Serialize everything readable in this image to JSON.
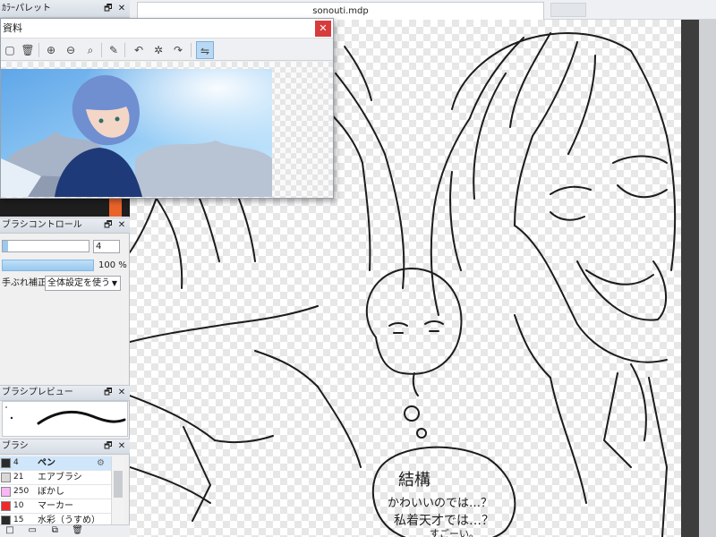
{
  "document": {
    "tab_title": "sonouti.mdp"
  },
  "panels": {
    "top": {
      "title": "ｶﾗｰパレット",
      "float_glyph": "🗗",
      "close_glyph": "✕"
    },
    "reference": {
      "title": "資料",
      "close_glyph": "✕",
      "tools": [
        "new-icon",
        "delete-icon",
        "zoom-in-icon",
        "zoom-out-icon",
        "zoom-reset-icon",
        "eyedropper-icon",
        "rotate-left-icon",
        "rotate-reset-icon",
        "rotate-right-icon",
        "flip-icon"
      ]
    },
    "brush_control": {
      "title": "ブラシコントロール",
      "size_value": "4",
      "opacity_value": "100 %",
      "stabilizer_label": "手ぶれ補正",
      "stabilizer_value": "全体設定を使う",
      "float_glyph": "🗗",
      "close_glyph": "✕",
      "size_fraction": 0.04,
      "opacity_fraction": 1.0
    },
    "brush_preview": {
      "title": "ブラシプレビュー",
      "float_glyph": "🗗",
      "close_glyph": "✕"
    },
    "brush": {
      "title": "ブラシ",
      "float_glyph": "🗗",
      "close_glyph": "✕",
      "items": [
        {
          "size": "4",
          "name": "ペン",
          "color": "#2a2a2a",
          "selected": true
        },
        {
          "size": "21",
          "name": "エアブラシ",
          "color": "#d8d8d8",
          "selected": false
        },
        {
          "size": "250",
          "name": "ぼかし",
          "color": "#f7b7f5",
          "selected": false
        },
        {
          "size": "10",
          "name": "マーカー",
          "color": "#ee2a2a",
          "selected": false
        },
        {
          "size": "15",
          "name": "水彩（うすめ）",
          "color": "#2a2a2a",
          "selected": false
        }
      ]
    }
  },
  "canvas": {
    "handwritten_text": [
      "結構",
      "かわいいのでは…？",
      "私着天才では…？",
      "すごーい。"
    ]
  },
  "colors": {
    "accent_blue": "#9cc9ec",
    "close_red": "#d83b3b",
    "orange": "#e9622a"
  }
}
